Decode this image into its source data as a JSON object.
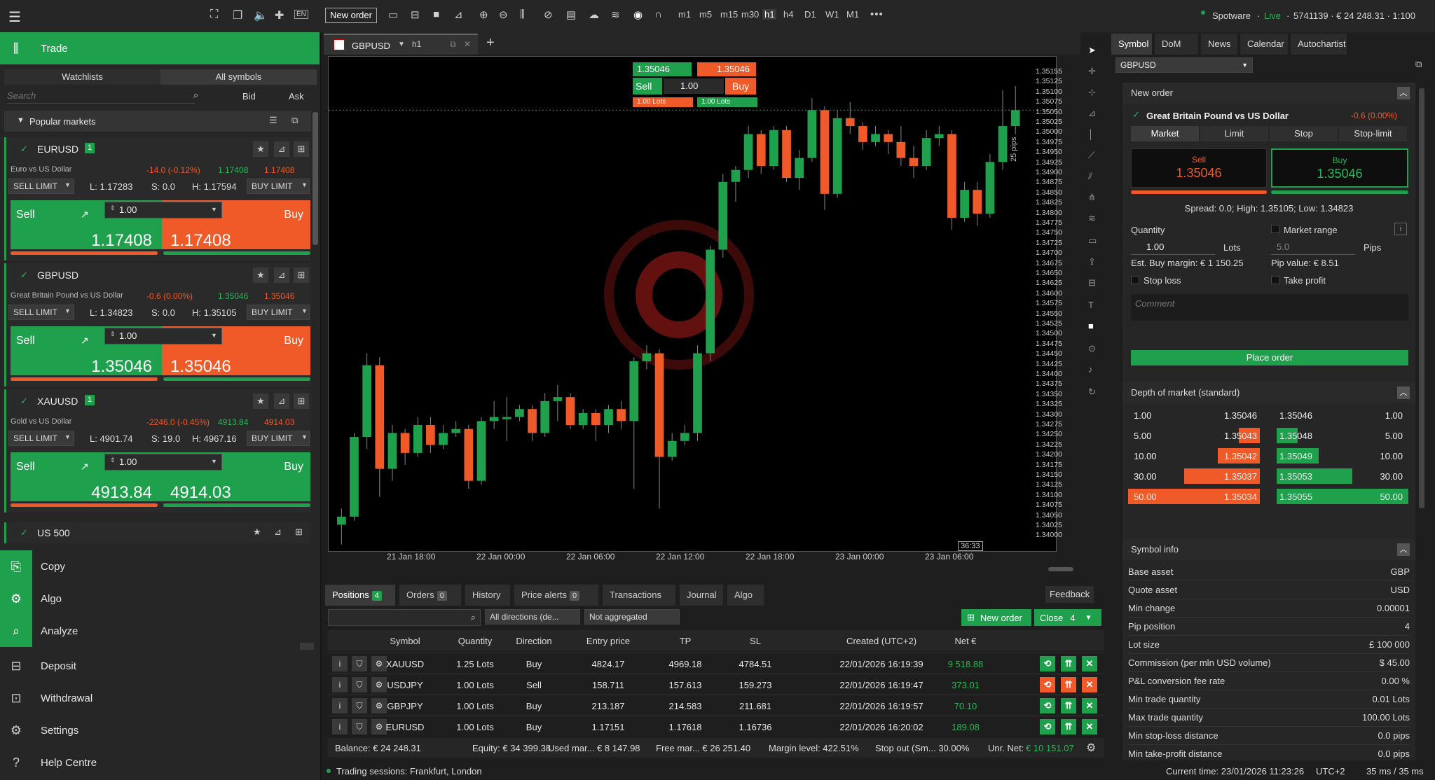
{
  "toolbar": {
    "new_order": "New order",
    "lang": "EN",
    "timeframes": [
      "m1",
      "m5",
      "m15",
      "m30",
      "h1",
      "h4",
      "D1",
      "W1",
      "M1"
    ],
    "account": "Spotware",
    "live": "Live",
    "account_info": "5741139 · € 24 248.31 · 1:100"
  },
  "left": {
    "trade": "Trade",
    "tab_watchlists": "Watchlists",
    "tab_all": "All symbols",
    "search_placeholder": "Search",
    "bid": "Bid",
    "ask": "Ask",
    "popular": "Popular markets",
    "cards": [
      {
        "sym": "EURUSD",
        "badge": "1",
        "desc": "Euro vs US Dollar",
        "chg": "-14.0 (-0.12%)",
        "bp": "1.17408",
        "ap": "1.17408",
        "sell_limit": "SELL LIMIT",
        "low": "L: 1.17283",
        "spread": "S: 0.0",
        "high": "H: 1.17594",
        "buy_limit": "BUY LIMIT",
        "qty": "1.00",
        "sell": "Sell",
        "buy": "Buy",
        "sell_price": "1.17408",
        "buy_price": "1.17408"
      },
      {
        "sym": "GBPUSD",
        "badge": "",
        "desc": "Great Britain Pound vs US Dollar",
        "chg": "-0.6 (0.00%)",
        "bp": "1.35046",
        "ap": "1.35046",
        "sell_limit": "SELL LIMIT",
        "low": "L: 1.34823",
        "spread": "S: 0.0",
        "high": "H: 1.35105",
        "buy_limit": "BUY LIMIT",
        "qty": "1.00",
        "sell": "Sell",
        "buy": "Buy",
        "sell_price": "1.35046",
        "buy_price": "1.35046"
      },
      {
        "sym": "XAUUSD",
        "badge": "1",
        "desc": "Gold vs US Dollar",
        "chg": "-2246.0 (-0.45%)",
        "bp": "4913.84",
        "ap": "4914.03",
        "sell_limit": "SELL LIMIT",
        "low": "L: 4901.74",
        "spread": "S: 19.0",
        "high": "H: 4967.16",
        "buy_limit": "BUY LIMIT",
        "qty": "1.00",
        "sell": "Sell",
        "buy": "Buy",
        "sell_price": "4913.84",
        "buy_price": "4914.03"
      }
    ],
    "card4_sym": "US 500",
    "nav": [
      "Copy",
      "Algo",
      "Analyze",
      "Deposit",
      "Withdrawal",
      "Settings",
      "Help Centre"
    ]
  },
  "chart": {
    "symbol": "GBPUSD",
    "tf": "h1",
    "sell_price": "1.35046",
    "buy_price": "1.35046",
    "sell": "Sell",
    "buy": "Buy",
    "qty": "1.00",
    "lots_sell": "1.00 Lots",
    "lots_buy": "1.00 Lots",
    "pips_label": "25 pips",
    "countdown": "36:33",
    "x_labels": [
      "21 Jan 18:00",
      "22 Jan 00:00",
      "22 Jan 06:00",
      "22 Jan 12:00",
      "22 Jan 18:00",
      "23 Jan 00:00",
      "23 Jan 06:00"
    ],
    "y_labels": [
      "1.35155",
      "1.35125",
      "1.35100",
      "1.35075",
      "1.35050",
      "1.35025",
      "1.35000",
      "1.34975",
      "1.34950",
      "1.34925",
      "1.34900",
      "1.34875",
      "1.34850",
      "1.34825",
      "1.34800",
      "1.34775",
      "1.34750",
      "1.34725",
      "1.34700",
      "1.34675",
      "1.34650",
      "1.34625",
      "1.34600",
      "1.34575",
      "1.34550",
      "1.34525",
      "1.34500",
      "1.34475",
      "1.34450",
      "1.34425",
      "1.34400",
      "1.34375",
      "1.34350",
      "1.34325",
      "1.34300",
      "1.34275",
      "1.34250",
      "1.34225",
      "1.34200",
      "1.34175",
      "1.34150",
      "1.34125",
      "1.34100",
      "1.34075",
      "1.34050",
      "1.34025",
      "1.34000"
    ],
    "watermark_color": "#7a1414"
  },
  "chart_data": {
    "type": "candlestick",
    "symbol": "GBPUSD",
    "timeframe": "h1",
    "ylim": [
      1.34,
      1.3517
    ],
    "candles": [
      [
        1.3401,
        1.3403,
        1.3396,
        1.3405
      ],
      [
        1.3403,
        1.3423,
        1.3402,
        1.3424
      ],
      [
        1.3423,
        1.3441,
        1.342,
        1.3444
      ],
      [
        1.3441,
        1.3415,
        1.3408,
        1.3443
      ],
      [
        1.3415,
        1.3424,
        1.3412,
        1.3426
      ],
      [
        1.3424,
        1.3419,
        1.3416,
        1.3425
      ],
      [
        1.3419,
        1.3426,
        1.3418,
        1.3428
      ],
      [
        1.3426,
        1.3421,
        1.3419,
        1.3428
      ],
      [
        1.3421,
        1.3424,
        1.342,
        1.3426
      ],
      [
        1.3424,
        1.3425,
        1.3423,
        1.3427
      ],
      [
        1.3425,
        1.3412,
        1.341,
        1.3426
      ],
      [
        1.3412,
        1.3427,
        1.3411,
        1.3428
      ],
      [
        1.3427,
        1.3428,
        1.3425,
        1.3432
      ],
      [
        1.3428,
        1.3428,
        1.3422,
        1.3433
      ],
      [
        1.3428,
        1.343,
        1.3427,
        1.3431
      ],
      [
        1.343,
        1.3424,
        1.3422,
        1.3431
      ],
      [
        1.3424,
        1.3432,
        1.3423,
        1.3434
      ],
      [
        1.3432,
        1.3433,
        1.3427,
        1.3436
      ],
      [
        1.3433,
        1.3426,
        1.3425,
        1.3434
      ],
      [
        1.3426,
        1.3429,
        1.3425,
        1.343
      ],
      [
        1.3429,
        1.3426,
        1.3422,
        1.343
      ],
      [
        1.3426,
        1.343,
        1.3424,
        1.3431
      ],
      [
        1.343,
        1.3427,
        1.3425,
        1.3432
      ],
      [
        1.3427,
        1.3442,
        1.341,
        1.3443
      ],
      [
        1.3442,
        1.3444,
        1.344,
        1.3446
      ],
      [
        1.3444,
        1.3418,
        1.3405,
        1.3445
      ],
      [
        1.3418,
        1.3422,
        1.3417,
        1.3424
      ],
      [
        1.3422,
        1.3424,
        1.3421,
        1.3426
      ],
      [
        1.3424,
        1.3444,
        1.3422,
        1.3446
      ],
      [
        1.3444,
        1.347,
        1.3442,
        1.3471
      ],
      [
        1.347,
        1.3487,
        1.3468,
        1.3489
      ],
      [
        1.3487,
        1.349,
        1.3482,
        1.3491
      ],
      [
        1.349,
        1.3499,
        1.3488,
        1.3501
      ],
      [
        1.3499,
        1.3491,
        1.3489,
        1.35
      ],
      [
        1.3491,
        1.35,
        1.349,
        1.3501
      ],
      [
        1.35,
        1.3488,
        1.3487,
        1.3501
      ],
      [
        1.3488,
        1.3493,
        1.3485,
        1.3495
      ],
      [
        1.3493,
        1.3505,
        1.3492,
        1.3508
      ],
      [
        1.3505,
        1.3484,
        1.348,
        1.3506
      ],
      [
        1.3484,
        1.3503,
        1.3483,
        1.3505
      ],
      [
        1.3503,
        1.3501,
        1.3499,
        1.3507
      ],
      [
        1.3501,
        1.3497,
        1.3495,
        1.3502
      ],
      [
        1.3497,
        1.3499,
        1.3496,
        1.3501
      ],
      [
        1.3499,
        1.3497,
        1.3494,
        1.35
      ],
      [
        1.3497,
        1.3493,
        1.3491,
        1.3501
      ],
      [
        1.3493,
        1.3491,
        1.3488,
        1.3496
      ],
      [
        1.3491,
        1.3498,
        1.349,
        1.35
      ],
      [
        1.3498,
        1.3499,
        1.3496,
        1.3501
      ],
      [
        1.3499,
        1.3478,
        1.3475,
        1.35
      ],
      [
        1.3478,
        1.3485,
        1.3477,
        1.3487
      ],
      [
        1.3485,
        1.3479,
        1.3476,
        1.3487
      ],
      [
        1.3479,
        1.3492,
        1.3478,
        1.3494
      ],
      [
        1.3492,
        1.3501,
        1.349,
        1.351
      ],
      [
        1.3501,
        1.3505,
        1.3499,
        1.3511
      ]
    ]
  },
  "bottom": {
    "tabs": [
      {
        "label": "Positions",
        "badge": "4"
      },
      {
        "label": "Orders",
        "badge": "0"
      },
      {
        "label": "History",
        "badge": ""
      },
      {
        "label": "Price alerts",
        "badge": "0"
      },
      {
        "label": "Transactions",
        "badge": ""
      },
      {
        "label": "Journal",
        "badge": ""
      },
      {
        "label": "Algo",
        "badge": ""
      }
    ],
    "feedback": "Feedback",
    "directions": "All directions (de...",
    "aggregation": "Not aggregated",
    "new_order": "New order",
    "close": "Close",
    "close_count": "4",
    "headers": [
      "Symbol",
      "Quantity",
      "Direction",
      "Entry price",
      "TP",
      "SL",
      "Created (UTC+2)",
      "Net €"
    ],
    "rows": [
      {
        "symbol": "XAUUSD",
        "qty": "1.25 Lots",
        "dir": "Buy",
        "entry": "4824.17",
        "tp": "4969.18",
        "sl": "4784.51",
        "created": "22/01/2026 16:19:39",
        "net": "9 518.88"
      },
      {
        "symbol": "USDJPY",
        "qty": "1.00 Lots",
        "dir": "Sell",
        "entry": "158.711",
        "tp": "157.613",
        "sl": "159.273",
        "created": "22/01/2026 16:19:47",
        "net": "373.01"
      },
      {
        "symbol": "GBPJPY",
        "qty": "1.00 Lots",
        "dir": "Buy",
        "entry": "213.187",
        "tp": "214.583",
        "sl": "211.681",
        "created": "22/01/2026 16:19:57",
        "net": "70.10"
      },
      {
        "symbol": "EURUSD",
        "qty": "1.00 Lots",
        "dir": "Buy",
        "entry": "1.17151",
        "tp": "1.17618",
        "sl": "1.16736",
        "created": "22/01/2026 16:20:02",
        "net": "189.08"
      }
    ],
    "status": {
      "balance": "Balance: € 24 248.31",
      "equity": "Equity: € 34 399.38",
      "used": "Used mar... € 8 147.98",
      "free": "Free mar... € 26 251.40",
      "level": "Margin level: 422.51%",
      "stopout": "Stop out (Sm... 30.00%",
      "unr_label": "Unr. Net:",
      "unr_value": "€ 10 151.07"
    }
  },
  "footer": {
    "sessions": "Trading sessions: Frankfurt, London",
    "time": "Current time: 23/01/2026 11:23:26",
    "tz": "UTC+2",
    "latency": "35 ms / 35 ms"
  },
  "right": {
    "tabs": [
      "Symbol",
      "DoM",
      "News",
      "Calendar",
      "Autochartist"
    ],
    "symbol": "GBPUSD",
    "new_order": "New order",
    "name": "Great Britain Pound vs US Dollar",
    "chg": "-0.6 (0.00%)",
    "order_types": [
      "Market",
      "Limit",
      "Stop",
      "Stop-limit"
    ],
    "sell": "Sell",
    "buy": "Buy",
    "sell_price": "1.35046",
    "buy_price": "1.35046",
    "spread": "Spread: 0.0; High: 1.35105; Low: 1.34823",
    "quantity": "Quantity",
    "qty": "1.00",
    "lots": "Lots",
    "market_range": "Market range",
    "range_value": "5.0",
    "pips": "Pips",
    "margin": "Est. Buy margin: € 1 150.25",
    "pip_value": "Pip value: € 8.51",
    "stop_loss": "Stop loss",
    "take_profit": "Take profit",
    "comment_placeholder": "Comment",
    "place_order": "Place order",
    "dom_title": "Depth of market (standard)",
    "dom_bids": [
      [
        "1.00",
        "1.35046"
      ],
      [
        "5.00",
        "1.35043"
      ],
      [
        "10.00",
        "1.35042"
      ],
      [
        "30.00",
        "1.35037"
      ],
      [
        "50.00",
        "1.35034"
      ]
    ],
    "dom_asks": [
      [
        "1.35046",
        "1.00"
      ],
      [
        "1.35048",
        "5.00"
      ],
      [
        "1.35049",
        "10.00"
      ],
      [
        "1.35053",
        "30.00"
      ],
      [
        "1.35055",
        "50.00"
      ]
    ],
    "info_title": "Symbol info",
    "info": [
      [
        "Base asset",
        "GBP"
      ],
      [
        "Quote asset",
        "USD"
      ],
      [
        "Min change",
        "0.00001"
      ],
      [
        "Pip position",
        "4"
      ],
      [
        "Lot size",
        "£ 100 000"
      ],
      [
        "Commission (per mln USD volume)",
        "$ 45.00"
      ],
      [
        "P&L conversion fee rate",
        "0.00 %"
      ],
      [
        "Min trade quantity",
        "0.01 Lots"
      ],
      [
        "Max trade quantity",
        "100.00 Lots"
      ],
      [
        "Min stop-loss distance",
        "0.0 pips"
      ],
      [
        "Min take-profit distance",
        "0.0 pips"
      ]
    ]
  },
  "colors": {
    "green": "#1fa04c",
    "orange": "#f05a28"
  }
}
